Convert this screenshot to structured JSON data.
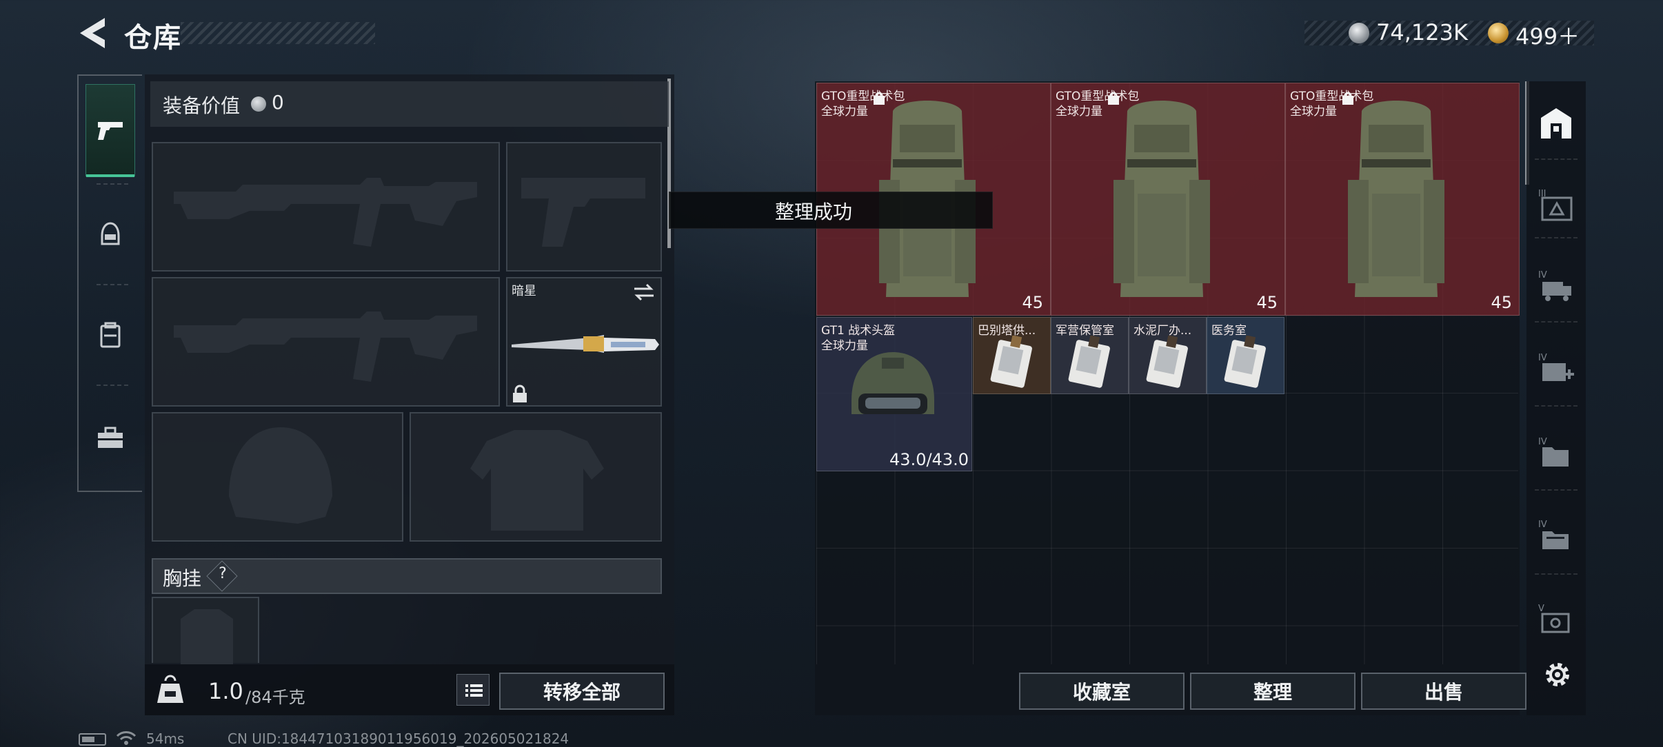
{
  "header": {
    "title": "仓库",
    "currency_silver": "74,123K",
    "currency_gold": "499＋",
    "back_icon": "back-arrow-icon"
  },
  "left_nav": {
    "items": [
      {
        "icon": "pistol-icon",
        "active": true
      },
      {
        "icon": "helmet-icon",
        "active": false
      },
      {
        "icon": "backpack-icon",
        "active": false
      },
      {
        "icon": "toolbox-icon",
        "active": false
      }
    ]
  },
  "loadout": {
    "equip_value_label": "装备价值",
    "equip_value": "0",
    "melee_name": "暗星",
    "chest_rig_label": "胸挂",
    "help_mark": "?",
    "weight_current": "1.0",
    "weight_max": "/84千克",
    "transfer_all_label": "转移全部"
  },
  "toast": {
    "message": "整理成功"
  },
  "stash": {
    "backpacks": [
      {
        "name": "GTO重型战术包",
        "sub": "全球力量",
        "capacity": "45"
      },
      {
        "name": "GTO重型战术包",
        "sub": "全球力量",
        "capacity": "45"
      },
      {
        "name": "GTO重型战术包",
        "sub": "全球力量",
        "capacity": "45"
      }
    ],
    "helmet": {
      "name": "GT1 战术头盔",
      "sub": "全球力量",
      "durability": "43.0/43.0"
    },
    "keys": [
      {
        "name": "巴别塔供..."
      },
      {
        "name": "军营保管室"
      },
      {
        "name": "水泥厂办..."
      },
      {
        "name": "医务室"
      }
    ],
    "colors": {
      "backpack_bg": "#70242c",
      "helmet_bg": "#2c3046",
      "key_gold_bg": "#463426",
      "key_blue_bg": "#2c3c54"
    }
  },
  "actions": {
    "collection_label": "收藏室",
    "organize_label": "整理",
    "sell_label": "出售"
  },
  "right_nav": {
    "items": [
      {
        "icon": "safe-box-icon",
        "label": ""
      },
      {
        "icon": "container-iii-icon",
        "label": "III"
      },
      {
        "icon": "container-iv-truck-icon",
        "label": "IV"
      },
      {
        "icon": "container-iv-medkit-icon",
        "label": "IV"
      },
      {
        "icon": "container-iv-folder-icon",
        "label": "IV"
      },
      {
        "icon": "container-iv-box-icon",
        "label": "IV"
      },
      {
        "icon": "container-v-icon",
        "label": "V"
      }
    ],
    "settings_icon": "gear-icon"
  },
  "status": {
    "ping": "54ms",
    "uid": "CN UID:18447103189011956019_202605021824"
  }
}
